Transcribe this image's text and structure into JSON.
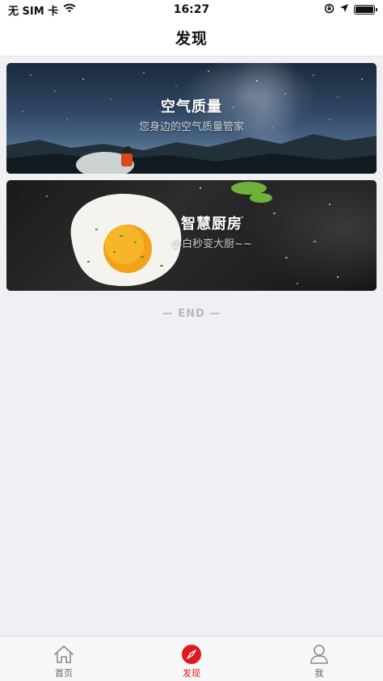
{
  "status_bar": {
    "carrier": "无 SIM 卡",
    "time": "16:27"
  },
  "nav": {
    "title": "发现"
  },
  "cards": [
    {
      "title": "空气质量",
      "subtitle": "您身边的空气质量管家"
    },
    {
      "title": "智慧厨房",
      "subtitle": "小白秒变大厨~~"
    }
  ],
  "end_label": "— END —",
  "tab_bar": {
    "items": [
      {
        "label": "首页",
        "icon": "home-icon"
      },
      {
        "label": "发现",
        "icon": "compass-icon",
        "active": true
      },
      {
        "label": "我",
        "icon": "user-icon"
      }
    ]
  },
  "colors": {
    "accent": "#e0191e",
    "background": "#efeff4"
  }
}
